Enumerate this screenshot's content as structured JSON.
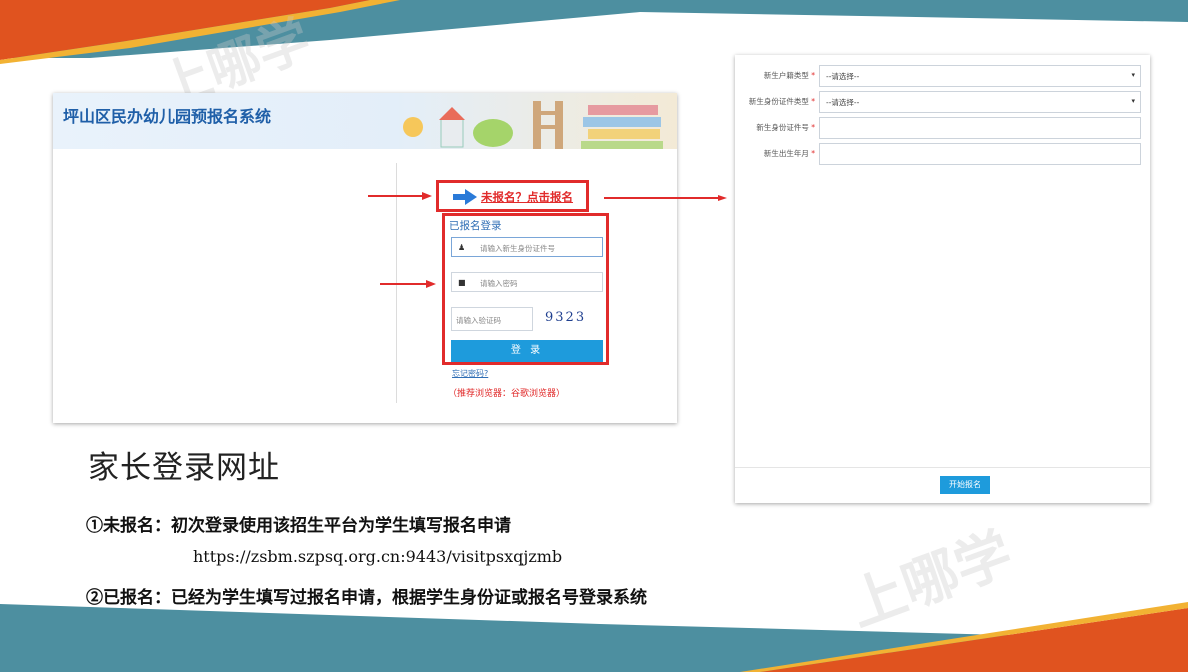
{
  "colors": {
    "accent_red": "#e12b2b",
    "brand_blue": "#1e9bdc",
    "band_teal": "#4d8fa0",
    "band_orange": "#e0531f"
  },
  "watermark": {
    "text": "上哪学"
  },
  "login": {
    "system_title": "坪山区民办幼儿园预报名系统",
    "register_link": "未报名？点击报名",
    "form_heading": "已报名登录",
    "id_placeholder": "请输入新生身份证件号",
    "password_placeholder": "请输入密码",
    "captcha_placeholder": "请输入验证码",
    "captcha_code": "9323",
    "login_button": "登 录",
    "forgot_link": "忘记密码?",
    "browser_tip": "（推荐浏览器：谷歌浏览器）",
    "icons": [
      "user-icon",
      "lock-icon",
      "arrow-right-icon"
    ]
  },
  "form": {
    "rows": [
      {
        "label": "新生户籍类型",
        "value": "--请选择--",
        "type": "select"
      },
      {
        "label": "新生身份证件类型",
        "value": "--请选择--",
        "type": "select"
      },
      {
        "label": "新生身份证件号",
        "value": "",
        "type": "input"
      },
      {
        "label": "新生出生年月",
        "value": "",
        "type": "input"
      }
    ],
    "required_mark": "*",
    "start_button": "开始报名"
  },
  "caption": {
    "title": "家长登录网址",
    "note1": "①未报名：初次登录使用该招生平台为学生填写报名申请",
    "url": "https://zsbm.szpsq.org.cn:9443/visitpsxqjzmb",
    "note2": "②已报名：已经为学生填写过报名申请，根据学生身份证或报名号登录系统"
  }
}
